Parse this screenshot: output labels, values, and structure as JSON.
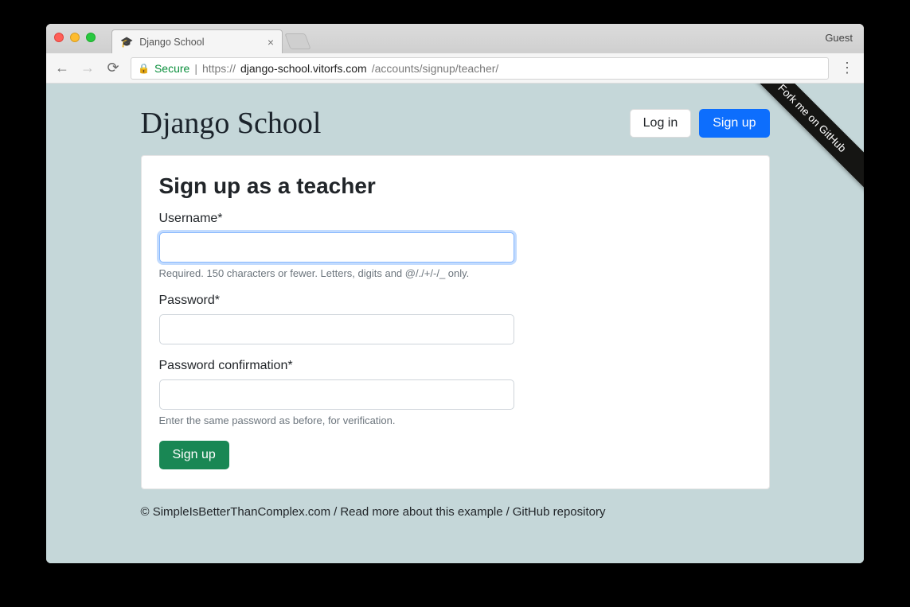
{
  "browser": {
    "tab_title": "Django School",
    "guest_label": "Guest",
    "secure_label": "Secure",
    "url_scheme": "https://",
    "url_host": "django-school.vitorfs.com",
    "url_path": "/accounts/signup/teacher/"
  },
  "ribbon": {
    "text": "Fork me on GitHub"
  },
  "brand": "Django School",
  "header_buttons": {
    "login": "Log in",
    "signup": "Sign up"
  },
  "form": {
    "title": "Sign up as a teacher",
    "fields": {
      "username": {
        "label": "Username*",
        "value": "",
        "help": "Required. 150 characters or fewer. Letters, digits and @/./+/-/_ only."
      },
      "password": {
        "label": "Password*",
        "value": ""
      },
      "password_confirm": {
        "label": "Password confirmation*",
        "value": "",
        "help": "Enter the same password as before, for verification."
      }
    },
    "submit": "Sign up"
  },
  "footer": {
    "copyright": "© SimpleIsBetterThanComplex.com",
    "sep": " / ",
    "link1": "Read more about this example",
    "link2": "GitHub repository"
  }
}
